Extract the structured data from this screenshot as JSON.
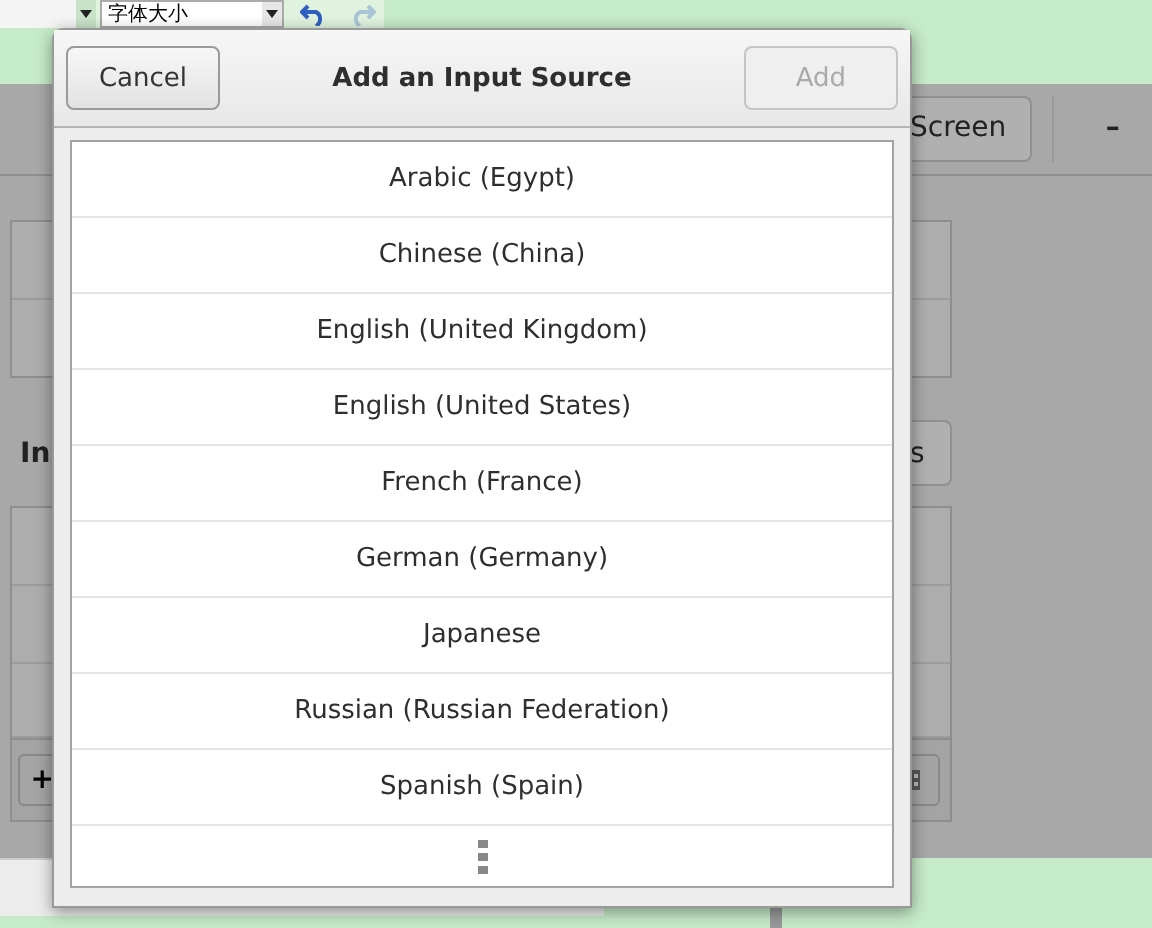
{
  "toolbar": {
    "font_size_field": {
      "value": "字体大小"
    },
    "undo": {
      "disabled": false
    },
    "redo": {
      "disabled": true
    }
  },
  "settings_window": {
    "header_button": "Screen",
    "minimize_button": "–",
    "section_label": "In",
    "side_button": "s",
    "add_button": "+"
  },
  "dialog": {
    "cancel_button": "Cancel",
    "title": "Add an Input Source",
    "add_button": {
      "label": "Add",
      "disabled": true
    },
    "languages": [
      {
        "label": "Arabic (Egypt)"
      },
      {
        "label": "Chinese (China)"
      },
      {
        "label": "English (United Kingdom)"
      },
      {
        "label": "English (United States)"
      },
      {
        "label": "French (France)"
      },
      {
        "label": "German (Germany)"
      },
      {
        "label": "Japanese"
      },
      {
        "label": "Russian (Russian Federation)"
      },
      {
        "label": "Spanish (Spain)"
      }
    ]
  }
}
